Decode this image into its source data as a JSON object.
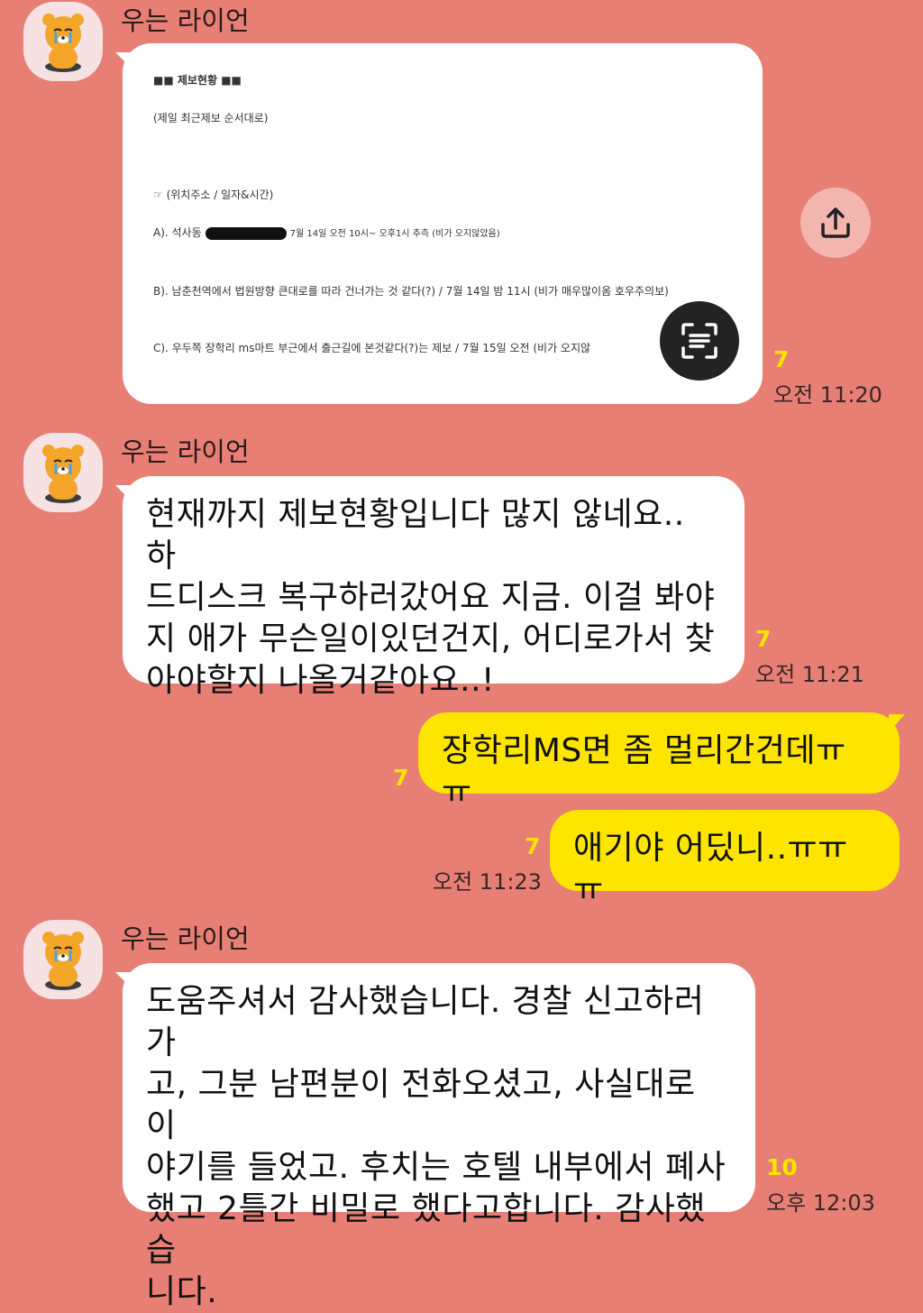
{
  "messages": [
    {
      "sender": "우는 라이언",
      "type": "image",
      "doc": {
        "heading": "■■ 제보현황 ■■",
        "subheading": "(제일 최근제보 순서대로)",
        "legend": "☞ (위치주소 / 일자&시간)",
        "entry_a_prefix": "A). 석사동",
        "entry_a_suffix": "7월 14일 오전 10시~ 오후1시 추측 (비가 오지않았음)",
        "entry_b": "B). 남춘천역에서 법원방향 큰대로를 따라 건너가는 것 같다(?)  /  7월 14일 밤 11시 (비가 매우많이옴 호우주의보)",
        "entry_c": "C). 우두쪽 장학리 ms마트 부근에서 출근길에 본것같다(?)는 제보  / 7월 15일 오전 (비가 오지않"
      },
      "unread": "7",
      "time": "오전 11:20"
    },
    {
      "sender": "우는 라이언",
      "type": "text",
      "text": "현재까지 제보현황입니다 많지 않네요.. 하\n드디스크 복구하러갔어요 지금. 이걸 봐야\n지 애가 무슨일이있던건지, 어디로가서 찾\n아야할지 나올거같아요..!",
      "unread": "7",
      "time": "오전 11:21"
    },
    {
      "sender": "me",
      "type": "text",
      "text": "장학리MS면 좀 멀리간건데ㅠㅠ",
      "unread": "7"
    },
    {
      "sender": "me",
      "type": "text",
      "text": "애기야 어딨니..ㅠㅠㅠ",
      "unread": "7",
      "time": "오전 11:23"
    },
    {
      "sender": "우는 라이언",
      "type": "text",
      "text": "도움주셔서 감사했습니다. 경찰 신고하러가\n고, 그분 남편분이 전화오셨고, 사실대로 이\n야기를 들었고. 후치는 호텔 내부에서 폐사\n했고 2틀간 비밀로 했다고합니다. 감사했습\n니다.",
      "unread": "10",
      "time": "오후 12:03"
    }
  ],
  "colors": {
    "background": "#e77f74",
    "incoming_bubble": "#ffffff",
    "outgoing_bubble": "#fee500",
    "unread_count": "#fee500"
  },
  "icons": {
    "avatar": "crying-lion-avatar-icon",
    "share": "share-upload-icon",
    "scan": "text-scan-icon"
  }
}
